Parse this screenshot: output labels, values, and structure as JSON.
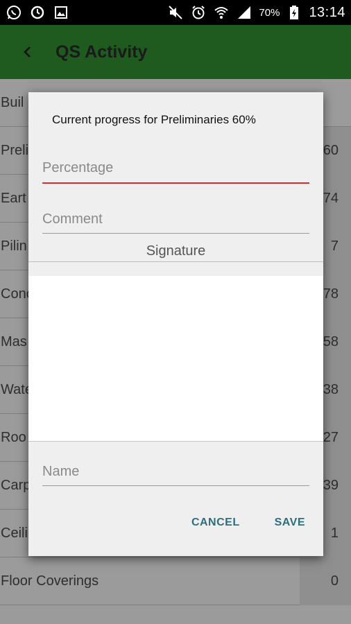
{
  "status_bar": {
    "battery": "70%",
    "time": "13:14",
    "left_icons": [
      "whatsapp-icon",
      "sync-icon",
      "image-icon"
    ],
    "right_icons": [
      "mute-icon",
      "alarm-icon",
      "wifi-icon",
      "signal-icon",
      "battery-icon"
    ]
  },
  "appbar": {
    "title": "QS Activity"
  },
  "list": {
    "rows": [
      {
        "label": "Buil",
        "value": ""
      },
      {
        "label": "Preli",
        "value": "60"
      },
      {
        "label": "Eart",
        "value": "74"
      },
      {
        "label": "Pilin",
        "value": "7"
      },
      {
        "label": "Conc",
        "value": "78"
      },
      {
        "label": "Mas",
        "value": "58"
      },
      {
        "label": "Wate",
        "value": "38"
      },
      {
        "label": "Roo",
        "value": "27"
      },
      {
        "label": "Carp",
        "value": "39"
      },
      {
        "label": "Ceili",
        "value": "1"
      },
      {
        "label": "Floor Coverings",
        "value": "0"
      }
    ]
  },
  "dialog": {
    "message": "Current progress for Preliminaries 60%",
    "percentage_placeholder": "Percentage",
    "comment_placeholder": "Comment",
    "signature_label": "Signature",
    "name_placeholder": "Name",
    "cancel_label": "CANCEL",
    "save_label": "SAVE"
  },
  "colors": {
    "appbar": "#1f5a1f",
    "accent_underline": "#e12a2a",
    "button_text": "#2b6f7f"
  }
}
